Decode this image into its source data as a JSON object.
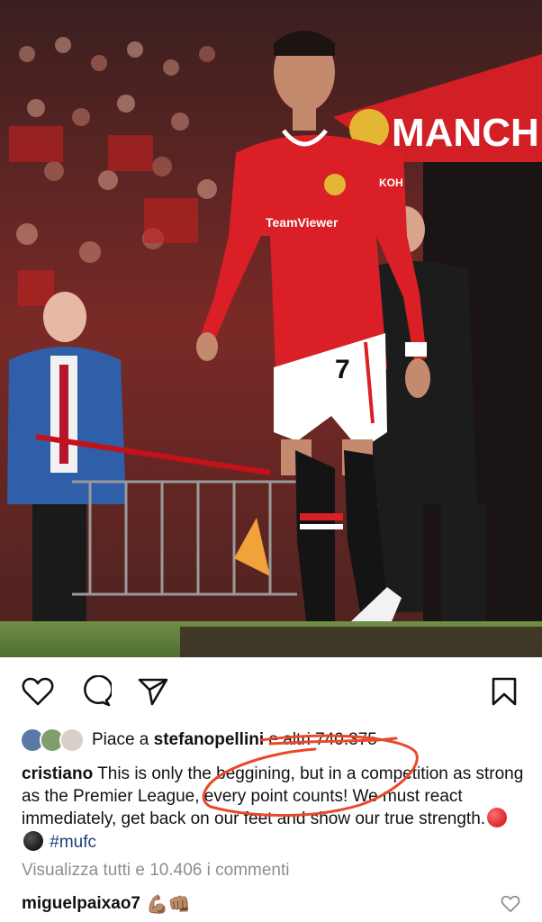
{
  "post": {
    "image_description_icon": "photo-icon",
    "banner_text": "MANCH",
    "shirt_sponsor": "TeamViewer",
    "shirt_number": "7",
    "shirt_brand": "KOH"
  },
  "actions": {
    "like_icon": "heart-icon",
    "comment_icon": "comment-icon",
    "share_icon": "send-icon",
    "save_icon": "bookmark-icon"
  },
  "likes": {
    "prefix": "Piace a ",
    "user": "stefanopellini",
    "suffix": " e altri 740.375"
  },
  "caption": {
    "user": "cristiano",
    "text": "This is only the beggining, but in a competition as strong as the Premier League, every point counts! We must react immediately, get back on our feet and show our true strength.",
    "hashtag": "#mufc"
  },
  "view_comments": "Visualizza tutti e 10.406 i commenti",
  "comment": {
    "user": "miguelpaixao7",
    "emoji": "💪🏽👊🏽"
  },
  "colors": {
    "annotation": "#e8492b",
    "hashtag": "#1e3f7a",
    "muted": "#8e8e8e"
  }
}
